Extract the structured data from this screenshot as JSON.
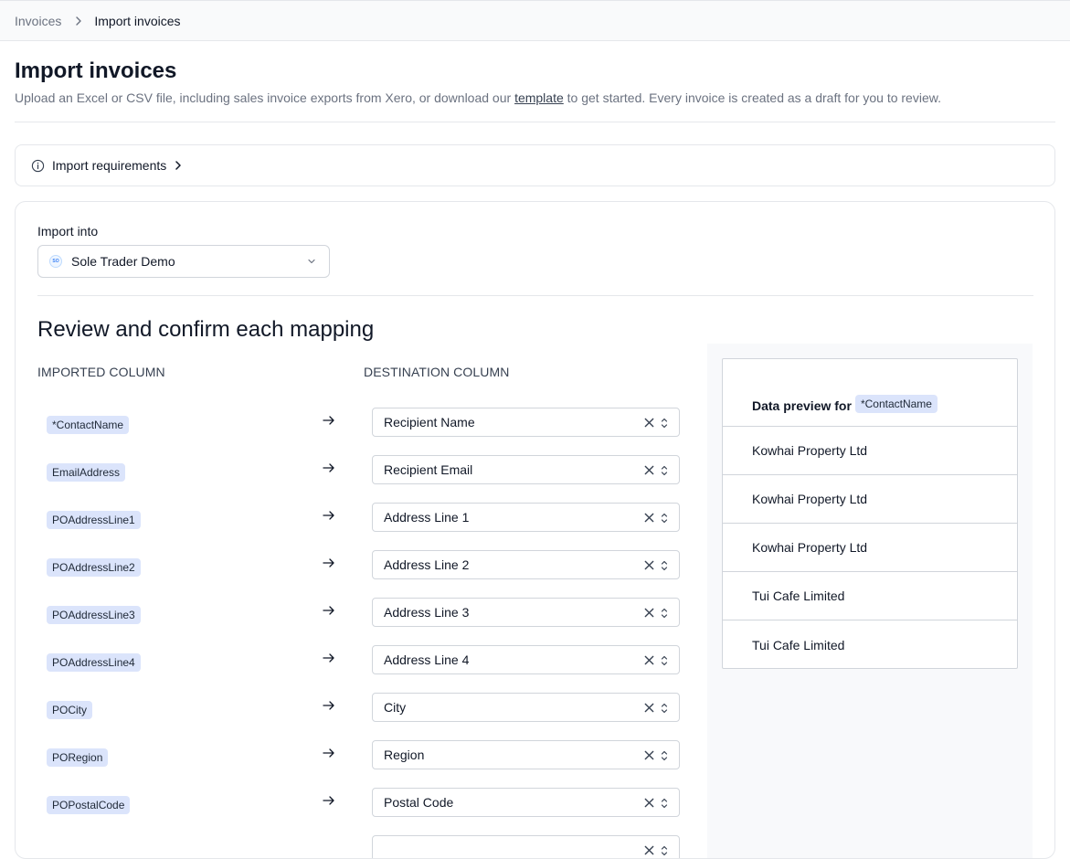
{
  "breadcrumb": {
    "parent": "Invoices",
    "current": "Import invoices"
  },
  "page": {
    "title": "Import invoices",
    "desc_before": "Upload an Excel or CSV file, including sales invoice exports from Xero, or download our ",
    "template_link": "template",
    "desc_after": " to get started. Every invoice is created as a draft for you to review."
  },
  "requirements": {
    "label": "Import requirements"
  },
  "import_into": {
    "label": "Import into",
    "org_initials": "SO",
    "selected": "Sole Trader Demo"
  },
  "mapping": {
    "title": "Review and confirm each mapping",
    "imported_header": "IMPORTED COLUMN",
    "destination_header": "DESTINATION COLUMN",
    "rows": [
      {
        "source": "*ContactName",
        "destination": "Recipient Name"
      },
      {
        "source": "EmailAddress",
        "destination": "Recipient Email"
      },
      {
        "source": "POAddressLine1",
        "destination": "Address Line 1"
      },
      {
        "source": "POAddressLine2",
        "destination": "Address Line 2"
      },
      {
        "source": "POAddressLine3",
        "destination": "Address Line 3"
      },
      {
        "source": "POAddressLine4",
        "destination": "Address Line 4"
      },
      {
        "source": "POCity",
        "destination": "City"
      },
      {
        "source": "PORegion",
        "destination": "Region"
      },
      {
        "source": "POPostalCode",
        "destination": "Postal Code"
      },
      {
        "source": "",
        "destination": ""
      }
    ]
  },
  "preview": {
    "title": "Data preview for",
    "column": "*ContactName",
    "values": [
      "Kowhai Property Ltd",
      "Kowhai Property Ltd",
      "Kowhai Property Ltd",
      "Tui Cafe Limited",
      "Tui Cafe Limited"
    ]
  }
}
